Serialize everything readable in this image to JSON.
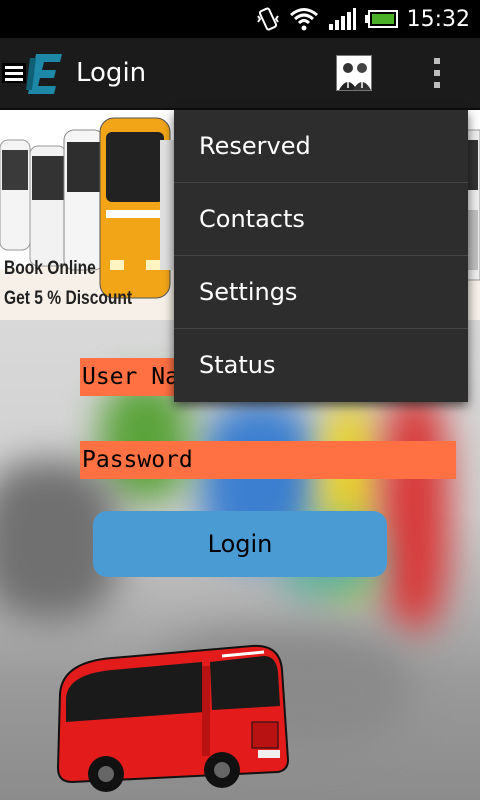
{
  "status_bar": {
    "time": "15:32",
    "icons": [
      "vibrate-icon",
      "wifi-icon",
      "signal-icon",
      "battery-icon"
    ]
  },
  "action_bar": {
    "title": "Login",
    "icons": [
      "menu-icon",
      "app-logo",
      "avatar-icon",
      "overflow-menu-icon"
    ]
  },
  "banner": {
    "line1": "Book Online",
    "line2": "Get 5 % Discount"
  },
  "form": {
    "username_placeholder": "User Na",
    "password_placeholder": "Password",
    "login_label": "Login"
  },
  "popup_menu": {
    "items": [
      "Reserved",
      "Contacts",
      "Settings",
      "Status"
    ]
  },
  "colors": {
    "field_bg": "#ff7043",
    "button_bg": "#4a9ad4",
    "menu_bg": "#2d2d2d",
    "actionbar_bg": "#1b1b1b"
  }
}
